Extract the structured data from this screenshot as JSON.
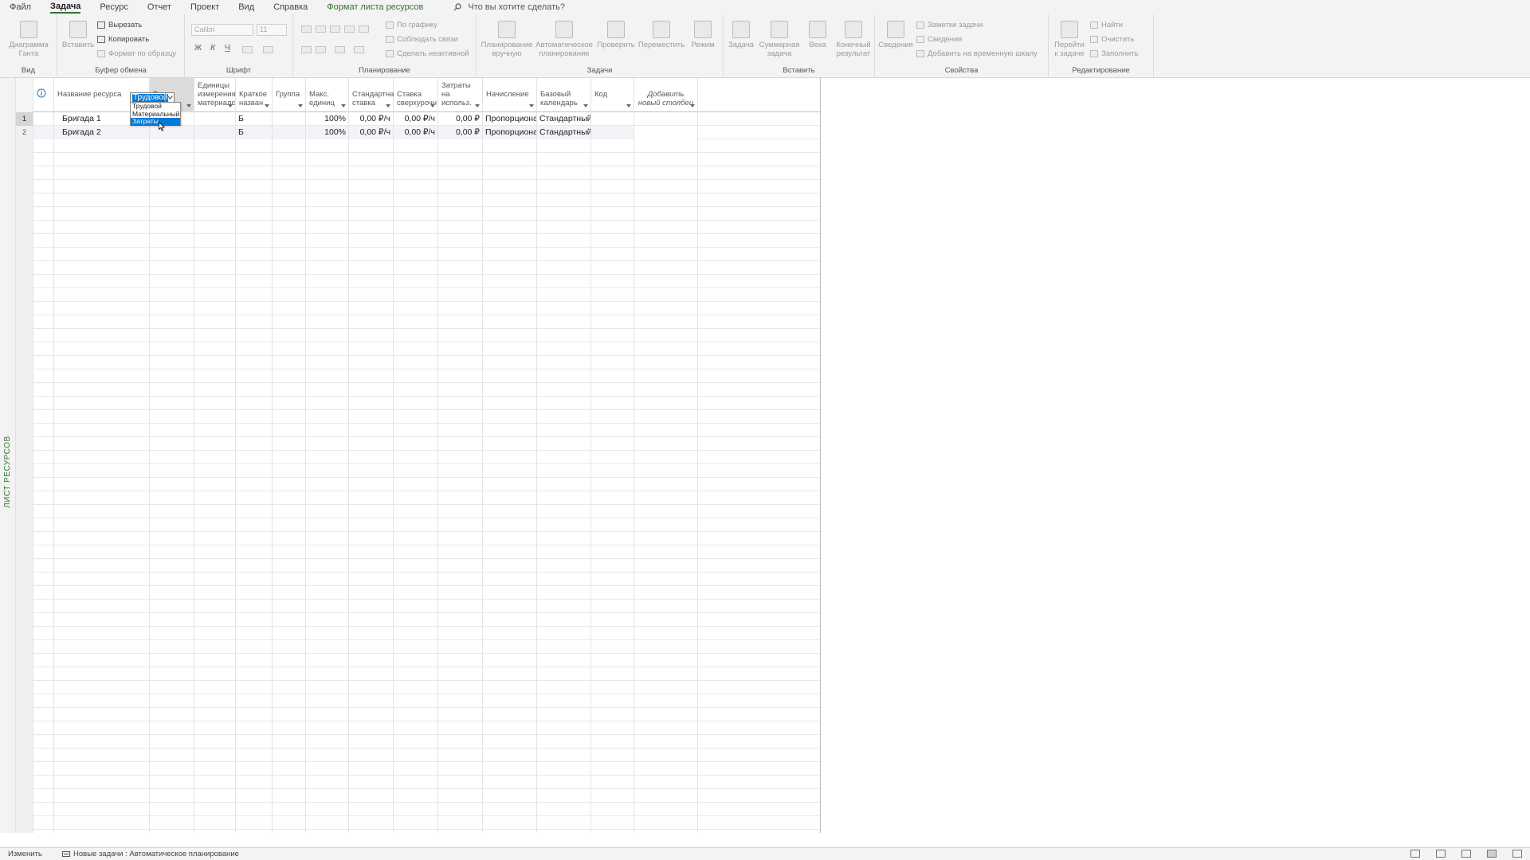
{
  "menu": {
    "tabs": [
      "Файл",
      "Задача",
      "Ресурс",
      "Отчет",
      "Проект",
      "Вид",
      "Справка"
    ],
    "active_tab": "Задача",
    "context_tab": "Формат листа ресурсов",
    "search_placeholder": "Что вы хотите сделать?"
  },
  "ribbon": {
    "view": {
      "gantt_label": "Диаграмма Ганта",
      "group": "Вид"
    },
    "clipboard": {
      "paste": "Вставить",
      "cut": "Вырезать",
      "copy": "Копировать",
      "format_painter": "Формат по образцу",
      "group": "Буфер обмена"
    },
    "font": {
      "font_name": "Calibri",
      "font_size": "11",
      "bold": "Ж",
      "italic": "К",
      "underline": "Ч",
      "group": "Шрифт"
    },
    "schedule": {
      "on_track": "По графику",
      "respect_links": "Соблюдать связи",
      "inactivate": "Сделать неактивной",
      "group": "Планирование"
    },
    "tasks": {
      "manual": "Планирование вручную",
      "auto": "Автоматическое планирование",
      "inspect": "Проверить",
      "move": "Переместить",
      "mode": "Режим",
      "group": "Задачи"
    },
    "insert": {
      "task": "Задача",
      "summary": "Суммарная задача",
      "milestone": "Веха",
      "deliverable": "Конечный результат",
      "group": "Вставить"
    },
    "properties": {
      "information": "Сведения",
      "task_notes": "Заметки задачи",
      "details": "Сведения",
      "add_timeline": "Добавить на временную шкалу",
      "group": "Свойства"
    },
    "editing": {
      "scroll_to": "Перейти к задаче",
      "find": "Найти",
      "clear": "Очистить",
      "fill": "Заполнить",
      "group": "Редактирование"
    }
  },
  "side_label": "ЛИСТ РЕСУРСОВ",
  "columns": [
    "Название ресурса",
    "Тип",
    "Единицы измерения материалс",
    "Краткое назван",
    "Группа",
    "Макс. единиц",
    "Стандартна ставка",
    "Ставка сверхурочн",
    "Затраты на использ.",
    "Начисление",
    "Базовый календарь",
    "Код",
    "Добавить новый столбец"
  ],
  "rows": [
    {
      "id": "1",
      "name": "Бригада 1",
      "type": "Трудовой",
      "material_label": "",
      "initials": "Б",
      "group": "",
      "max_units": "100%",
      "std_rate": "0,00 ₽/ч",
      "ovt_rate": "0,00 ₽/ч",
      "cost_use": "0,00 ₽",
      "accrue": "Пропорционально",
      "calendar": "Стандартный",
      "code": ""
    },
    {
      "id": "2",
      "name": "Бригада 2",
      "type": "",
      "material_label": "",
      "initials": "Б",
      "group": "",
      "max_units": "100%",
      "std_rate": "0,00 ₽/ч",
      "ovt_rate": "0,00 ₽/ч",
      "cost_use": "0,00 ₽",
      "accrue": "Пропорционально",
      "calendar": "Стандартный",
      "code": ""
    }
  ],
  "type_dropdown": {
    "selected": "Трудовой",
    "options": [
      "Трудовой",
      "Материальный",
      "Затраты"
    ],
    "highlighted": "Затраты"
  },
  "status": {
    "mode": "Изменить",
    "new_tasks": "Новые задачи : Автоматическое планирование"
  }
}
